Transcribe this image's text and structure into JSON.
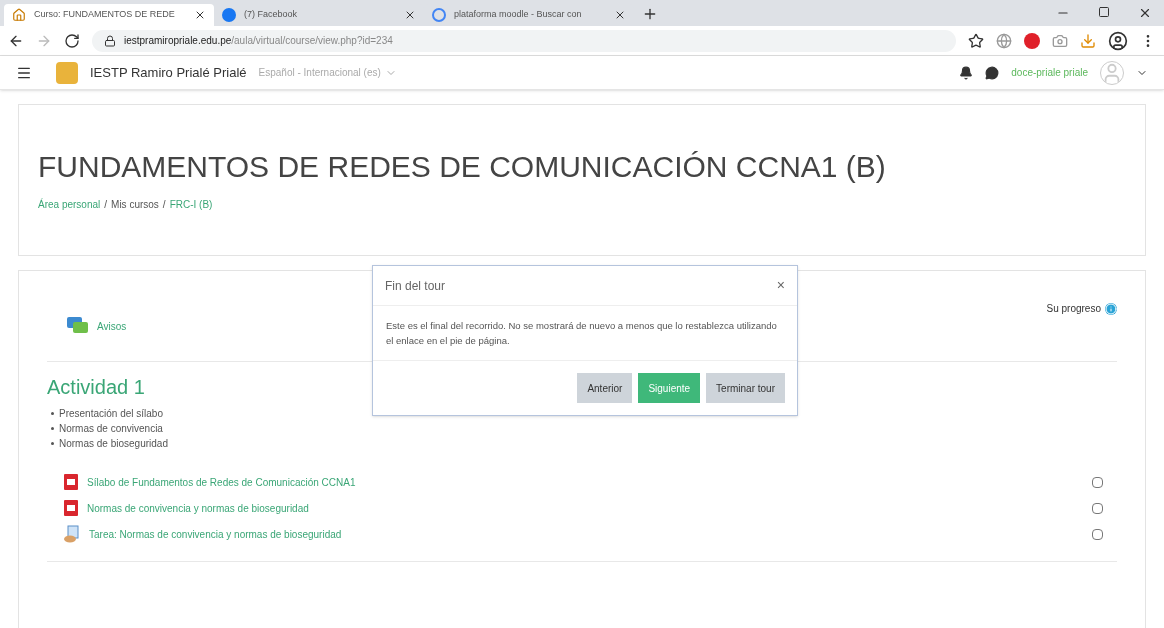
{
  "browser": {
    "tabs": [
      {
        "title": "Curso: FUNDAMENTOS DE REDE",
        "selected": true,
        "kind": "home"
      },
      {
        "title": "(7) Facebook",
        "selected": false,
        "kind": "facebook"
      },
      {
        "title": "plataforma moodle - Buscar con",
        "selected": false,
        "kind": "google"
      }
    ],
    "url_host": "iestpramiropriale.edu.pe",
    "url_path": "/aula/virtual/course/view.php?id=234"
  },
  "navbar": {
    "site_name": "IESTP Ramiro Prialé Prialé",
    "language": "Español - Internacional (es)",
    "user": "doce-priale priale"
  },
  "header": {
    "title": "FUNDAMENTOS DE REDES DE COMUNICACIÓN CCNA1 (B)",
    "breadcrumb": [
      {
        "label": "Área personal",
        "link": true
      },
      {
        "label": "Mis cursos",
        "link": false
      },
      {
        "label": "FRC-I (B)",
        "link": true
      }
    ],
    "separator": "/"
  },
  "course": {
    "news": "Avisos",
    "progress_label": "Su progreso",
    "section": {
      "title": "Actividad 1",
      "bullets": [
        "Presentación del sílabo",
        "Normas de convivencia",
        "Normas de bioseguridad"
      ],
      "activities": [
        {
          "kind": "pdf",
          "label": "Sílabo de Fundamentos de Redes de Comunicación CCNA1",
          "checked": false
        },
        {
          "kind": "pdf",
          "label": "Normas de convivencia y normas de bioseguridad",
          "checked": false
        },
        {
          "kind": "assign",
          "label": "Tarea: Normas de convivencia y normas de bioseguridad",
          "checked": false
        }
      ]
    }
  },
  "tour_dialog": {
    "title": "Fin del tour",
    "close": "×",
    "body": "Este es el final del recorrido. No se mostrará de nuevo a menos que lo restablezca utilizando el enlace en el pie de página.",
    "buttons": [
      {
        "label": "Anterior",
        "kind": "secondary"
      },
      {
        "label": "Siguiente",
        "kind": "primary"
      },
      {
        "label": "Terminar tour",
        "kind": "secondary"
      }
    ]
  }
}
